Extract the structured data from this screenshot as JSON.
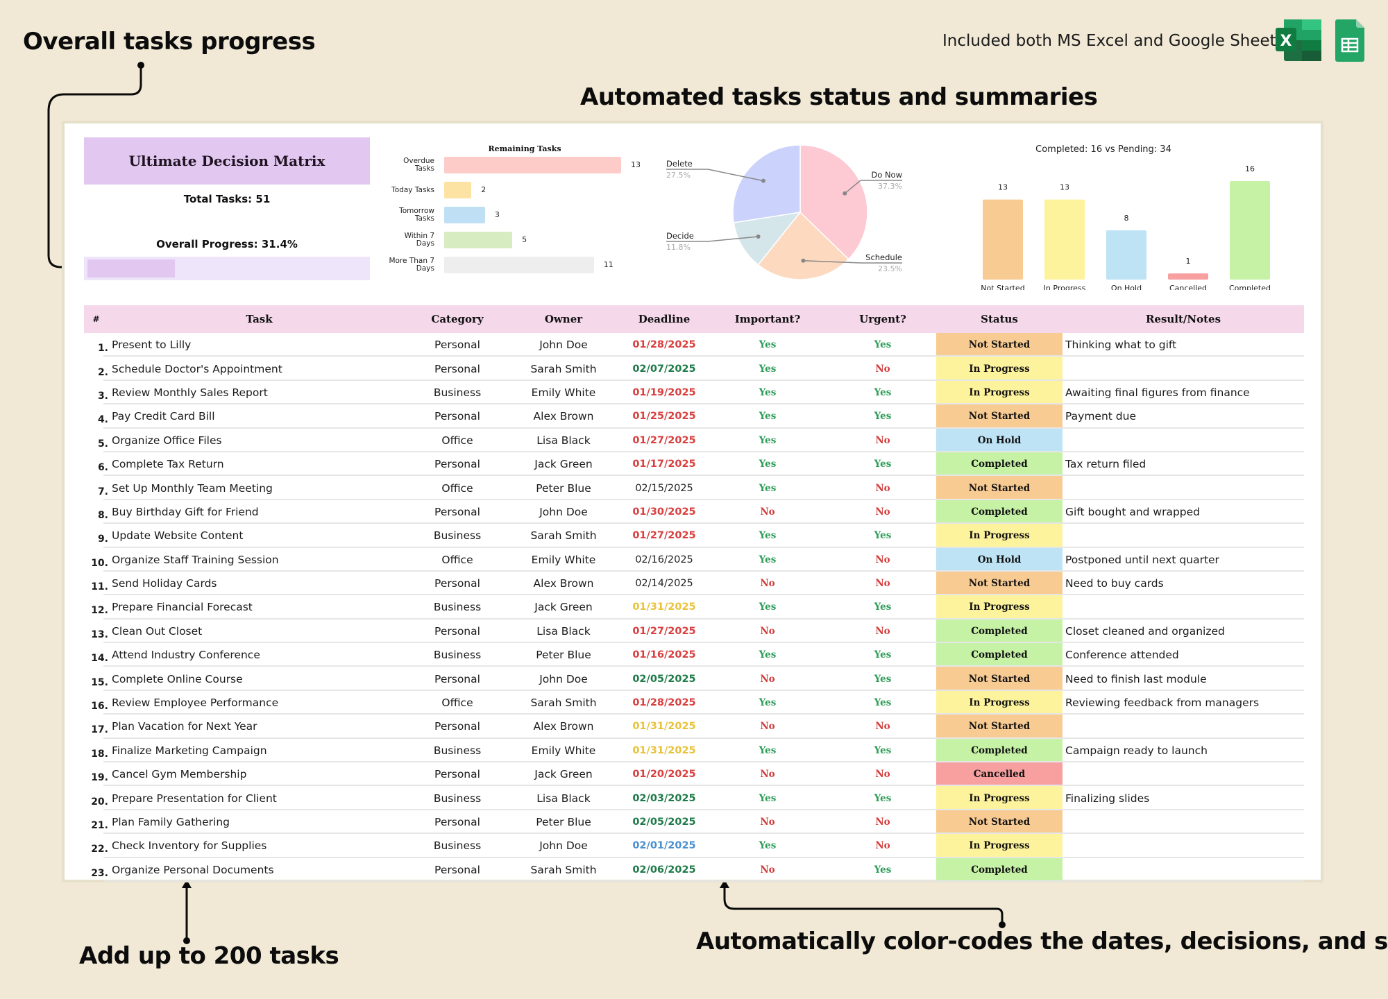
{
  "annotations": {
    "overall_progress": "Overall tasks progress",
    "automated": "Automated tasks status and summaries",
    "add_tasks": "Add up to 200 tasks",
    "color_codes": "Automatically color-codes the dates, decisions, and status.",
    "included": "Included both MS Excel and Google Sheets"
  },
  "icons": {
    "excel": "microsoft-excel-icon",
    "sheets": "google-sheets-icon",
    "excel_letter": "X"
  },
  "summary": {
    "title": "Ultimate Decision Matrix",
    "total_tasks_label": "Total Tasks: 51",
    "overall_progress_label": "Overall Progress: 31.4%",
    "overall_progress_value": 0.314,
    "progress_color": "#e2c8f1",
    "track_color": "#efe5fb"
  },
  "chart_data": [
    {
      "type": "bar",
      "orientation": "horizontal",
      "title": "Remaining Tasks",
      "categories": [
        "Overdue Tasks",
        "Today Tasks",
        "Tomorrow Tasks",
        "Within 7 Days",
        "More Than 7 Days"
      ],
      "label_lines": [
        [
          "Overdue",
          "Tasks"
        ],
        [
          "Today Tasks"
        ],
        [
          "Tomorrow",
          "Tasks"
        ],
        [
          "Within 7",
          "Days"
        ],
        [
          "More Than 7",
          "Days"
        ]
      ],
      "values": [
        13,
        2,
        3,
        5,
        11
      ],
      "colors": [
        "#fdccc8",
        "#fde3a3",
        "#bfe0f4",
        "#d8ecc2",
        "#eeeeee"
      ],
      "xlim": [
        0,
        13
      ],
      "grid": false,
      "data_labels": true
    },
    {
      "type": "pie",
      "title": "",
      "categories": [
        "Do Now",
        "Schedule",
        "Decide",
        "Delete"
      ],
      "values": [
        37.3,
        23.5,
        11.8,
        27.5
      ],
      "labels": [
        "37.3%",
        "23.5%",
        "11.8%",
        "27.5%"
      ],
      "colors": [
        "#fdc9d3",
        "#fcd9bf",
        "#d4e6ea",
        "#cbd2fb"
      ],
      "legend": "callout-labels"
    },
    {
      "type": "bar",
      "orientation": "vertical",
      "title": "Completed: 16 vs Pending: 34",
      "categories": [
        "Not Started",
        "In Progress",
        "On Hold",
        "Cancelled",
        "Completed"
      ],
      "values": [
        13,
        13,
        8,
        1,
        16
      ],
      "colors": [
        "#f8cb93",
        "#fdf39c",
        "#bde3f4",
        "#f8a0a0",
        "#c6f2a6"
      ],
      "ylim": [
        0,
        16
      ],
      "grid": false,
      "data_labels": true
    }
  ],
  "table": {
    "headers": [
      "#",
      "Task",
      "Category",
      "Owner",
      "Deadline",
      "Important?",
      "Urgent?",
      "Status",
      "Result/Notes"
    ],
    "colors": {
      "date_overdue": "#d93f3f",
      "date_future": "#1e7a48",
      "date_today": "#e8c23a",
      "date_tomorrow": "#4a8fd0",
      "date_normal": "#222222",
      "yes": "#2e9d58",
      "no": "#d33c3c",
      "status": {
        "Not Started": "#f8cb93",
        "In Progress": "#fdf39c",
        "On Hold": "#bde3f4",
        "Completed": "#c6f2a6",
        "Cancelled": "#f8a0a0"
      }
    },
    "rows": [
      {
        "num": "1.",
        "task": "Present to Lilly",
        "category": "Personal",
        "owner": "John Doe",
        "deadline": "01/28/2025",
        "date_state": "overdue",
        "important": "Yes",
        "urgent": "Yes",
        "status": "Not Started",
        "notes": "Thinking what to gift"
      },
      {
        "num": "2.",
        "task": "Schedule Doctor's Appointment",
        "category": "Personal",
        "owner": "Sarah Smith",
        "deadline": "02/07/2025",
        "date_state": "future",
        "important": "Yes",
        "urgent": "No",
        "status": "In Progress",
        "notes": ""
      },
      {
        "num": "3.",
        "task": "Review Monthly Sales Report",
        "category": "Business",
        "owner": "Emily White",
        "deadline": "01/19/2025",
        "date_state": "overdue",
        "important": "Yes",
        "urgent": "Yes",
        "status": "In Progress",
        "notes": "Awaiting final figures from finance"
      },
      {
        "num": "4.",
        "task": "Pay Credit Card Bill",
        "category": "Personal",
        "owner": "Alex Brown",
        "deadline": "01/25/2025",
        "date_state": "overdue",
        "important": "Yes",
        "urgent": "Yes",
        "status": "Not Started",
        "notes": "Payment due"
      },
      {
        "num": "5.",
        "task": "Organize Office Files",
        "category": "Office",
        "owner": "Lisa Black",
        "deadline": "01/27/2025",
        "date_state": "overdue",
        "important": "Yes",
        "urgent": "No",
        "status": "On Hold",
        "notes": ""
      },
      {
        "num": "6.",
        "task": "Complete Tax Return",
        "category": "Personal",
        "owner": "Jack Green",
        "deadline": "01/17/2025",
        "date_state": "overdue",
        "important": "Yes",
        "urgent": "Yes",
        "status": "Completed",
        "notes": "Tax return filed"
      },
      {
        "num": "7.",
        "task": "Set Up Monthly Team Meeting",
        "category": "Office",
        "owner": "Peter Blue",
        "deadline": "02/15/2025",
        "date_state": "normal",
        "important": "Yes",
        "urgent": "No",
        "status": "Not Started",
        "notes": ""
      },
      {
        "num": "8.",
        "task": "Buy Birthday Gift for Friend",
        "category": "Personal",
        "owner": "John Doe",
        "deadline": "01/30/2025",
        "date_state": "overdue",
        "important": "No",
        "urgent": "No",
        "status": "Completed",
        "notes": "Gift bought and wrapped"
      },
      {
        "num": "9.",
        "task": "Update Website Content",
        "category": "Business",
        "owner": "Sarah Smith",
        "deadline": "01/27/2025",
        "date_state": "overdue",
        "important": "Yes",
        "urgent": "Yes",
        "status": "In Progress",
        "notes": ""
      },
      {
        "num": "10.",
        "task": "Organize Staff Training Session",
        "category": "Office",
        "owner": "Emily White",
        "deadline": "02/16/2025",
        "date_state": "normal",
        "important": "Yes",
        "urgent": "No",
        "status": "On Hold",
        "notes": "Postponed until next quarter"
      },
      {
        "num": "11.",
        "task": "Send Holiday Cards",
        "category": "Personal",
        "owner": "Alex Brown",
        "deadline": "02/14/2025",
        "date_state": "normal",
        "important": "No",
        "urgent": "No",
        "status": "Not Started",
        "notes": "Need to buy cards"
      },
      {
        "num": "12.",
        "task": "Prepare Financial Forecast",
        "category": "Business",
        "owner": "Jack Green",
        "deadline": "01/31/2025",
        "date_state": "today",
        "important": "Yes",
        "urgent": "Yes",
        "status": "In Progress",
        "notes": ""
      },
      {
        "num": "13.",
        "task": "Clean Out Closet",
        "category": "Personal",
        "owner": "Lisa Black",
        "deadline": "01/27/2025",
        "date_state": "overdue",
        "important": "No",
        "urgent": "No",
        "status": "Completed",
        "notes": "Closet cleaned and organized"
      },
      {
        "num": "14.",
        "task": "Attend Industry Conference",
        "category": "Business",
        "owner": "Peter Blue",
        "deadline": "01/16/2025",
        "date_state": "overdue",
        "important": "Yes",
        "urgent": "Yes",
        "status": "Completed",
        "notes": "Conference attended"
      },
      {
        "num": "15.",
        "task": "Complete Online Course",
        "category": "Personal",
        "owner": "John Doe",
        "deadline": "02/05/2025",
        "date_state": "future",
        "important": "No",
        "urgent": "Yes",
        "status": "Not Started",
        "notes": "Need to finish last module"
      },
      {
        "num": "16.",
        "task": "Review Employee Performance",
        "category": "Office",
        "owner": "Sarah Smith",
        "deadline": "01/28/2025",
        "date_state": "overdue",
        "important": "Yes",
        "urgent": "Yes",
        "status": "In Progress",
        "notes": "Reviewing feedback from managers"
      },
      {
        "num": "17.",
        "task": "Plan Vacation for Next Year",
        "category": "Personal",
        "owner": "Alex Brown",
        "deadline": "01/31/2025",
        "date_state": "today",
        "important": "No",
        "urgent": "No",
        "status": "Not Started",
        "notes": ""
      },
      {
        "num": "18.",
        "task": "Finalize Marketing Campaign",
        "category": "Business",
        "owner": "Emily White",
        "deadline": "01/31/2025",
        "date_state": "today",
        "important": "Yes",
        "urgent": "Yes",
        "status": "Completed",
        "notes": "Campaign ready to launch"
      },
      {
        "num": "19.",
        "task": "Cancel Gym Membership",
        "category": "Personal",
        "owner": "Jack Green",
        "deadline": "01/20/2025",
        "date_state": "overdue",
        "important": "No",
        "urgent": "No",
        "status": "Cancelled",
        "notes": ""
      },
      {
        "num": "20.",
        "task": "Prepare Presentation for Client",
        "category": "Business",
        "owner": "Lisa Black",
        "deadline": "02/03/2025",
        "date_state": "future",
        "important": "Yes",
        "urgent": "Yes",
        "status": "In Progress",
        "notes": "Finalizing slides"
      },
      {
        "num": "21.",
        "task": "Plan Family Gathering",
        "category": "Personal",
        "owner": "Peter Blue",
        "deadline": "02/05/2025",
        "date_state": "future",
        "important": "No",
        "urgent": "No",
        "status": "Not Started",
        "notes": ""
      },
      {
        "num": "22.",
        "task": "Check Inventory for Supplies",
        "category": "Business",
        "owner": "John Doe",
        "deadline": "02/01/2025",
        "date_state": "tomorrow",
        "important": "Yes",
        "urgent": "No",
        "status": "In Progress",
        "notes": ""
      },
      {
        "num": "23.",
        "task": "Organize Personal Documents",
        "category": "Personal",
        "owner": "Sarah Smith",
        "deadline": "02/06/2025",
        "date_state": "future",
        "important": "No",
        "urgent": "Yes",
        "status": "Completed",
        "notes": ""
      }
    ]
  }
}
